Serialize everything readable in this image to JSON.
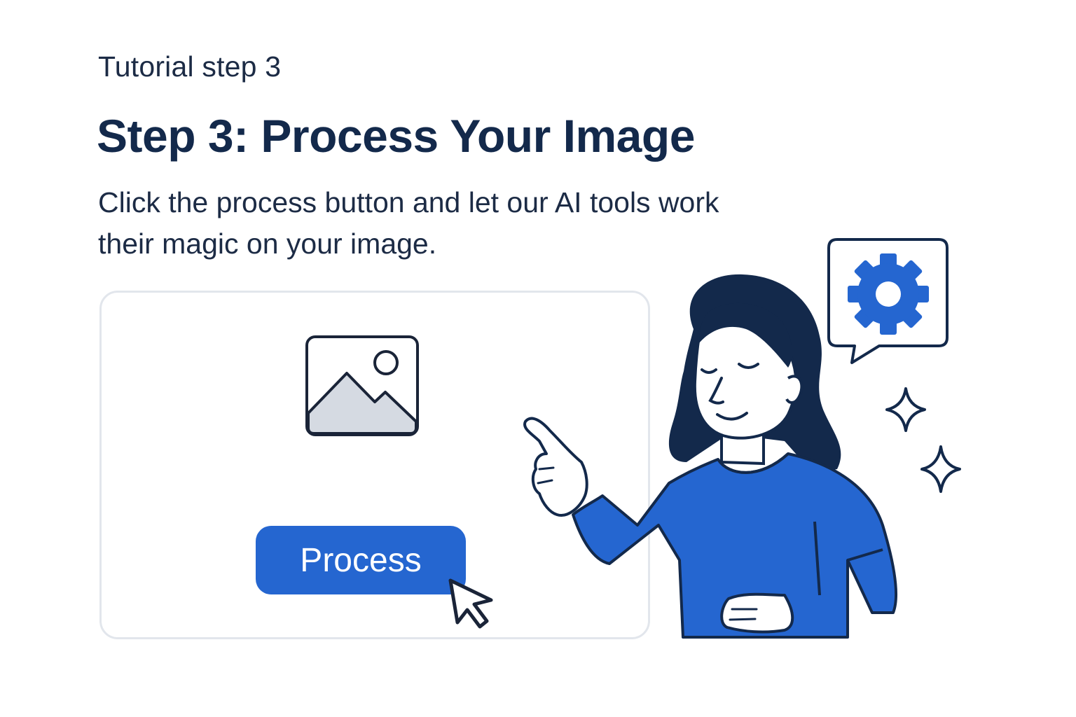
{
  "header": {
    "kicker": "Tutorial step 3",
    "title": "Step 3: Process Your Image",
    "subtitle": "Click the process button and let our AI tools work their magic on your image."
  },
  "card": {
    "image_icon": "image-placeholder-icon",
    "process_label": "Process",
    "cursor_icon": "mouse-pointer-icon"
  },
  "illustration": {
    "person": "woman-pointing-illustration",
    "bubble_icon": "gear-icon",
    "sparkle_icon": "sparkle-icon"
  },
  "colors": {
    "accent": "#2566d0",
    "navy": "#13294b",
    "text": "#1c2b45",
    "card_border": "#e2e6ec",
    "placeholder_fill": "#d5dae2"
  }
}
